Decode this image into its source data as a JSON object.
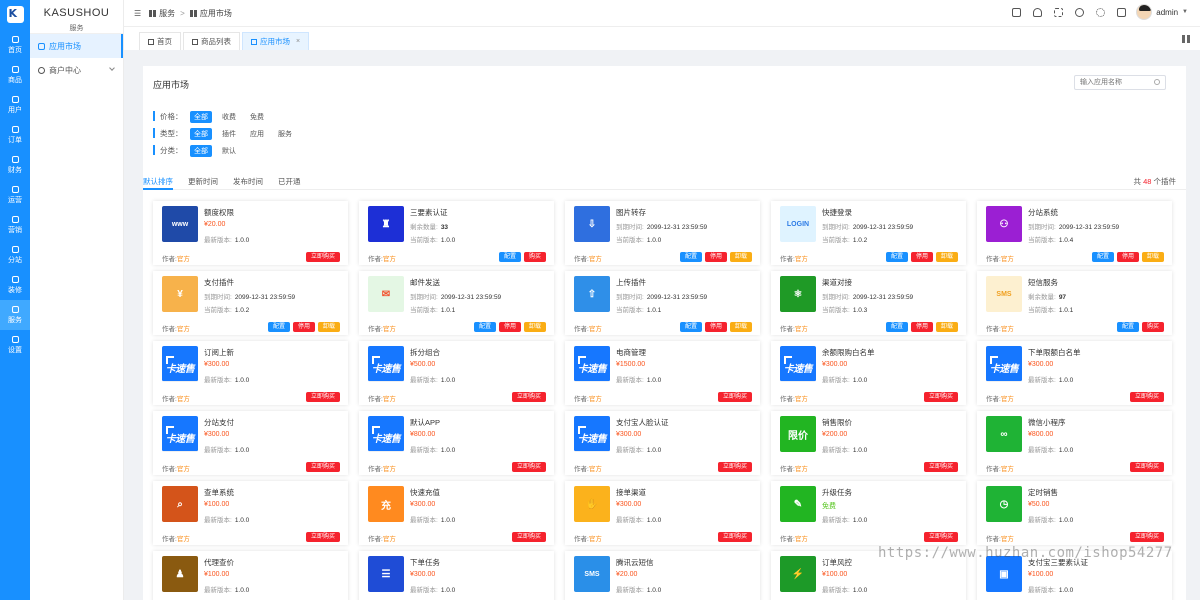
{
  "rail": [
    {
      "label": "首页",
      "icon": "home-icon"
    },
    {
      "label": "商品",
      "icon": "goods-icon"
    },
    {
      "label": "用户",
      "icon": "user-icon"
    },
    {
      "label": "订单",
      "icon": "order-icon"
    },
    {
      "label": "财务",
      "icon": "finance-icon"
    },
    {
      "label": "运营",
      "icon": "operation-icon"
    },
    {
      "label": "营销",
      "icon": "marketing-icon"
    },
    {
      "label": "分站",
      "icon": "substation-icon"
    },
    {
      "label": "装修",
      "icon": "decoration-icon"
    },
    {
      "label": "服务",
      "icon": "service-icon"
    },
    {
      "label": "设置",
      "icon": "settings-icon"
    }
  ],
  "brand": {
    "name": "KASUSHOU",
    "sub": "服务",
    "logo_letter": "K"
  },
  "subnav": [
    {
      "label": "应用市场"
    },
    {
      "label": "商户中心"
    }
  ],
  "breadcrumb": {
    "parent": "服务",
    "current": "应用市场"
  },
  "user": {
    "name": "admin"
  },
  "tabs": [
    {
      "label": "首页"
    },
    {
      "label": "商品列表"
    },
    {
      "label": "应用市场",
      "close": "×"
    }
  ],
  "panel": {
    "title": "应用市场",
    "search_placeholder": "输入应用名称",
    "filters": [
      {
        "label": "价格：",
        "options": [
          "全部",
          "收费",
          "免费"
        ]
      },
      {
        "label": "类型：",
        "options": [
          "全部",
          "插件",
          "应用",
          "服务"
        ]
      },
      {
        "label": "分类：",
        "options": [
          "全部",
          "默认"
        ]
      }
    ],
    "sorts": [
      "默认排序",
      "更新时间",
      "发布时间",
      "已开通"
    ],
    "count": {
      "prefix": "共",
      "num": "48",
      "suffix": "个插件"
    }
  },
  "colors": {
    "primary": "#1890ff",
    "danger": "#f5222d",
    "warning": "#faad14",
    "price": "#fa541c",
    "free": "#52c41a"
  },
  "common": {
    "author_label": "作者:",
    "author": "官方",
    "expire_label": "到期时间:",
    "version_label": "最新版本:",
    "current_version_label": "当前版本:",
    "stock_label": "剩余数量:",
    "buy": "立即购买",
    "config": "配置",
    "stop": "停用",
    "unload": "卸载",
    "buy_short": "购买"
  },
  "cards": [
    {
      "name": "额度权限",
      "price": "¥20.00",
      "ver_label": "最新版本:",
      "ver": "1.0.0",
      "icon_text": "www",
      "icon_name": "www-icon",
      "icon_color": "#1f4aa8",
      "btns": [
        "buy"
      ]
    },
    {
      "name": "三要素认证",
      "stock": "33",
      "ver_label": "当前版本:",
      "ver": "1.0.0",
      "icon_text": "♜",
      "icon_name": "shield-user-icon",
      "icon_color": "#1d2fd6",
      "btns": [
        "config",
        "buy_short"
      ]
    },
    {
      "name": "图片转存",
      "expire": "2099-12-31 23:59:59",
      "ver_label": "当前版本:",
      "ver": "1.0.0",
      "icon_text": "⇩",
      "icon_name": "save-icon",
      "icon_color": "#2f6fdf",
      "btns": [
        "config",
        "stop",
        "unload"
      ]
    },
    {
      "name": "快捷登录",
      "expire": "2099-12-31 23:59:59",
      "ver_label": "当前版本:",
      "ver": "1.0.2",
      "icon_text": "LOGIN",
      "icon_name": "login-icon",
      "icon_color": "#dff3ff",
      "icon_fg": "#2c7be5",
      "btns": [
        "config",
        "stop",
        "unload"
      ]
    },
    {
      "name": "分站系统",
      "expire": "2099-12-31 23:59:59",
      "ver_label": "当前版本:",
      "ver": "1.0.4",
      "icon_text": "⚇",
      "icon_name": "network-icon",
      "icon_color": "#9b1fd3",
      "btns": [
        "config",
        "stop",
        "unload"
      ]
    },
    {
      "name": "支付插件",
      "expire": "2099-12-31 23:59:59",
      "ver_label": "当前版本:",
      "ver": "1.0.2",
      "icon_text": "¥",
      "icon_name": "payment-icon",
      "icon_color": "#f7b24b",
      "btns": [
        "config",
        "stop",
        "unload"
      ]
    },
    {
      "name": "邮件发送",
      "expire": "2099-12-31 23:59:59",
      "ver_label": "当前版本:",
      "ver": "1.0.1",
      "icon_text": "✉",
      "icon_name": "mail-icon",
      "icon_color": "#e4f7e4",
      "icon_fg": "#f2522e",
      "btns": [
        "config",
        "stop",
        "unload"
      ]
    },
    {
      "name": "上传插件",
      "expire": "2099-12-31 23:59:59",
      "ver_label": "当前版本:",
      "ver": "1.0.1",
      "icon_text": "⇧",
      "icon_name": "upload-icon",
      "icon_color": "#2f8fe8",
      "btns": [
        "config",
        "stop",
        "unload"
      ]
    },
    {
      "name": "渠道对接",
      "expire": "2099-12-31 23:59:59",
      "ver_label": "当前版本:",
      "ver": "1.0.3",
      "icon_text": "⚛",
      "icon_name": "channel-icon",
      "icon_color": "#1f9a26",
      "btns": [
        "config",
        "stop",
        "unload"
      ]
    },
    {
      "name": "短信服务",
      "stock": "97",
      "ver_label": "当前版本:",
      "ver": "1.0.1",
      "icon_text": "SMS",
      "icon_name": "sms-icon",
      "icon_color": "#fdf0d0",
      "icon_fg": "#f0a020",
      "btns": [
        "config",
        "buy_short"
      ]
    },
    {
      "name": "订阅上新",
      "price": "¥300.00",
      "ver_label": "最新版本:",
      "ver": "1.0.0",
      "icon_text": "卡速售",
      "icon_name": "kasushou-logo-icon",
      "icon_color": "#1677ff",
      "brand": true,
      "btns": [
        "buy"
      ]
    },
    {
      "name": "拆分组合",
      "price": "¥500.00",
      "ver_label": "最新版本:",
      "ver": "1.0.0",
      "icon_text": "卡速售",
      "icon_name": "kasushou-logo-icon",
      "icon_color": "#1677ff",
      "brand": true,
      "btns": [
        "buy"
      ]
    },
    {
      "name": "电商管理",
      "price": "¥1500.00",
      "ver_label": "最新版本:",
      "ver": "1.0.0",
      "icon_text": "卡速售",
      "icon_name": "kasushou-logo-icon",
      "icon_color": "#1677ff",
      "brand": true,
      "btns": [
        "buy"
      ]
    },
    {
      "name": "余额限购白名单",
      "price": "¥300.00",
      "ver_label": "最新版本:",
      "ver": "1.0.0",
      "icon_text": "卡速售",
      "icon_name": "kasushou-logo-icon",
      "icon_color": "#1677ff",
      "brand": true,
      "btns": [
        "buy"
      ]
    },
    {
      "name": "下单限额白名单",
      "price": "¥300.00",
      "ver_label": "最新版本:",
      "ver": "1.0.0",
      "icon_text": "卡速售",
      "icon_name": "kasushou-logo-icon",
      "icon_color": "#1677ff",
      "brand": true,
      "btns": [
        "buy"
      ]
    },
    {
      "name": "分站支付",
      "price": "¥300.00",
      "ver_label": "最新版本:",
      "ver": "1.0.0",
      "icon_text": "卡速售",
      "icon_name": "kasushou-logo-icon",
      "icon_color": "#1677ff",
      "brand": true,
      "btns": [
        "buy"
      ]
    },
    {
      "name": "默认APP",
      "price": "¥800.00",
      "ver_label": "最新版本:",
      "ver": "1.0.0",
      "icon_text": "卡速售",
      "icon_name": "kasushou-logo-icon",
      "icon_color": "#1677ff",
      "brand": true,
      "btns": [
        "buy"
      ]
    },
    {
      "name": "支付宝人脸认证",
      "price": "¥300.00",
      "ver_label": "最新版本:",
      "ver": "1.0.0",
      "icon_text": "卡速售",
      "icon_name": "kasushou-logo-icon",
      "icon_color": "#1677ff",
      "brand": true,
      "btns": [
        "buy"
      ]
    },
    {
      "name": "销售限价",
      "price": "¥200.00",
      "ver_label": "最新版本:",
      "ver": "1.0.0",
      "icon_text": "限价",
      "icon_name": "price-limit-icon",
      "icon_color": "#22b522",
      "btns": [
        "buy"
      ]
    },
    {
      "name": "微信小程序",
      "price": "¥800.00",
      "ver_label": "最新版本:",
      "ver": "1.0.0",
      "icon_text": "∞",
      "icon_name": "miniprogram-icon",
      "icon_color": "#1fb335",
      "btns": [
        "buy"
      ]
    },
    {
      "name": "查单系统",
      "price": "¥100.00",
      "ver_label": "最新版本:",
      "ver": "1.0.0",
      "icon_text": "⌕",
      "icon_name": "order-search-icon",
      "icon_color": "#d4541a",
      "btns": [
        "buy"
      ]
    },
    {
      "name": "快速充值",
      "price": "¥300.00",
      "ver_label": "最新版本:",
      "ver": "1.0.0",
      "icon_text": "充",
      "icon_name": "recharge-icon",
      "icon_color": "#ff8a1f",
      "btns": [
        "buy"
      ]
    },
    {
      "name": "接单渠道",
      "price": "¥300.00",
      "ver_label": "最新版本:",
      "ver": "1.0.0",
      "icon_text": "✋",
      "icon_name": "order-channel-icon",
      "icon_color": "#fbb21c",
      "btns": [
        "buy"
      ]
    },
    {
      "name": "升级任务",
      "price": "免费",
      "free": true,
      "ver_label": "最新版本:",
      "ver": "1.0.0",
      "icon_text": "✎",
      "icon_name": "upgrade-task-icon",
      "icon_color": "#22b522",
      "btns": [
        "buy"
      ]
    },
    {
      "name": "定时销售",
      "price": "¥50.00",
      "ver_label": "最新版本:",
      "ver": "1.0.0",
      "icon_text": "◷",
      "icon_name": "timer-icon",
      "icon_color": "#1fb335",
      "btns": [
        "buy"
      ]
    },
    {
      "name": "代理查价",
      "price": "¥100.00",
      "ver_label": "最新版本:",
      "ver": "1.0.0",
      "icon_text": "♟",
      "icon_name": "agent-price-icon",
      "icon_color": "#8a5a10",
      "btns": []
    },
    {
      "name": "下单任务",
      "price": "¥300.00",
      "ver_label": "最新版本:",
      "ver": "1.0.0",
      "icon_text": "☰",
      "icon_name": "order-task-icon",
      "icon_color": "#1f4cd6",
      "btns": []
    },
    {
      "name": "腾讯云短信",
      "price": "¥20.00",
      "ver_label": "最新版本:",
      "ver": "1.0.0",
      "icon_text": "SMS",
      "icon_name": "tencent-sms-icon",
      "icon_color": "#2a8fe8",
      "btns": []
    },
    {
      "name": "订单风控",
      "price": "¥100.00",
      "ver_label": "最新版本:",
      "ver": "1.0.0",
      "icon_text": "⚡",
      "icon_name": "risk-control-icon",
      "icon_color": "#1d9a28",
      "btns": []
    },
    {
      "name": "支付宝三要素认证",
      "price": "¥100.00",
      "ver_label": "最新版本:",
      "ver": "1.0.0",
      "icon_text": "▣",
      "icon_name": "id-card-icon",
      "icon_color": "#1677ff",
      "btns": []
    }
  ],
  "watermark": "https://www.huzhan.com/ishop54277"
}
